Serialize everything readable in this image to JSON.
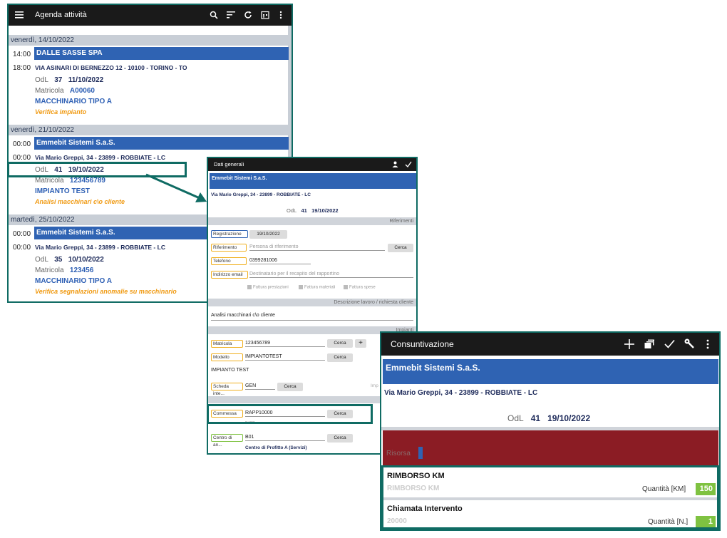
{
  "agenda": {
    "title": "Agenda attività",
    "days": [
      {
        "date": "venerdì, 14/10/2022",
        "time_start": "14:00",
        "time_end": "18:00",
        "customer": "DALLE SASSE SPA",
        "address": "VIA ASINARI DI BERNEZZO 12 - 10100 - TORINO - TO",
        "odl_label": "OdL",
        "odl_number": "37",
        "odl_date": "11/10/2022",
        "matricola_label": "Matricola",
        "matricola": "A00060",
        "machine": "MACCHINARIO TIPO A",
        "activity": "Verifica impianto"
      },
      {
        "date": "venerdì, 21/10/2022",
        "time_start": "00:00",
        "time_end": "00:00",
        "customer": "Emmebit Sistemi S.a.S.",
        "address": "Via Mario Greppi, 34 - 23899 - ROBBIATE - LC",
        "odl_label": "OdL",
        "odl_number": "41",
        "odl_date": "19/10/2022",
        "matricola_label": "Matricola",
        "matricola": "123456789",
        "machine": "IMPIANTO TEST",
        "activity": "Analisi macchinari c\\o cliente"
      },
      {
        "date": "martedì, 25/10/2022",
        "time_start": "00:00",
        "time_end": "00:00",
        "customer": "Emmebit Sistemi S.a.S.",
        "address": "Via Mario Greppi, 34 - 23899 - ROBBIATE - LC",
        "odl_label": "OdL",
        "odl_number": "35",
        "odl_date": "10/10/2022",
        "matricola_label": "Matricola",
        "matricola": "123456",
        "machine": "MACCHINARIO TIPO A",
        "activity": "Verifica segnalazioni anomalie su macchinario"
      }
    ]
  },
  "dati": {
    "title": "Dati generali",
    "customer": "Emmebit Sistemi S.a.S.",
    "address": "Via Mario Greppi, 34 - 23899 - ROBBIATE - LC",
    "odl_label": "OdL",
    "odl_number": "41",
    "odl_date": "19/10/2022",
    "sec_riferimenti": "Riferimenti",
    "registrazione_label": "Registrazione",
    "registrazione_value": "19/10/2022",
    "riferimento_label": "Riferimento",
    "riferimento_placeholder": "Persona di riferimento",
    "telefono_label": "Telefono",
    "telefono_value": "0399281006",
    "email_label": "Indirizzo email",
    "email_placeholder": "Destinatario per il recapito del rapportino",
    "chk_prestazioni": "Fattura prestazioni",
    "chk_materiali": "Fattura materiali",
    "chk_spese": "Fattura spese",
    "sec_descrizione": "Descrizione lavoro / richiesta cliente",
    "descrizione": "Analisi macchinari c\\o cliente",
    "sec_impianti": "Impianti",
    "matricola_label": "Matricola",
    "matricola_value": "123456789",
    "modello_label": "Modello",
    "modello_value": "IMPIANTOTEST",
    "impianto_name": "IMPIANTO TEST",
    "scheda_label": "Scheda inte...",
    "scheda_value": "GEN",
    "impianto_partial": "Imp",
    "commessa_label": "Commessa",
    "commessa_value": "RAPP10000",
    "commessa_sub": "RAPP",
    "centro_label": "Centro di an...",
    "centro_value": "B01",
    "centro_desc": "Centro di Profitto A (Servizi)",
    "cerca": "Cerca"
  },
  "cons": {
    "title": "Consuntivazione",
    "customer": "Emmebit Sistemi S.a.S.",
    "address": "Via Mario Greppi, 34 - 23899 - ROBBIATE - LC",
    "odl_label": "OdL",
    "odl_number": "41",
    "odl_date": "19/10/2022",
    "risorsa_label": "Risorsa",
    "items": [
      {
        "title": "RIMBORSO KM",
        "code": "RIMBORSO KM",
        "qty_label": "Quantità [KM]",
        "qty": "150"
      },
      {
        "title": "Chiamata Intervento",
        "code": "20000",
        "qty_label": "Quantità [N.]",
        "qty": "1"
      }
    ]
  },
  "colors": {
    "accent_teal": "#0f6b63",
    "customer_blue": "#2f63b3",
    "activity_orange": "#f09a12",
    "risorsa_red": "#8b1c24",
    "qty_green": "#7fc241"
  }
}
